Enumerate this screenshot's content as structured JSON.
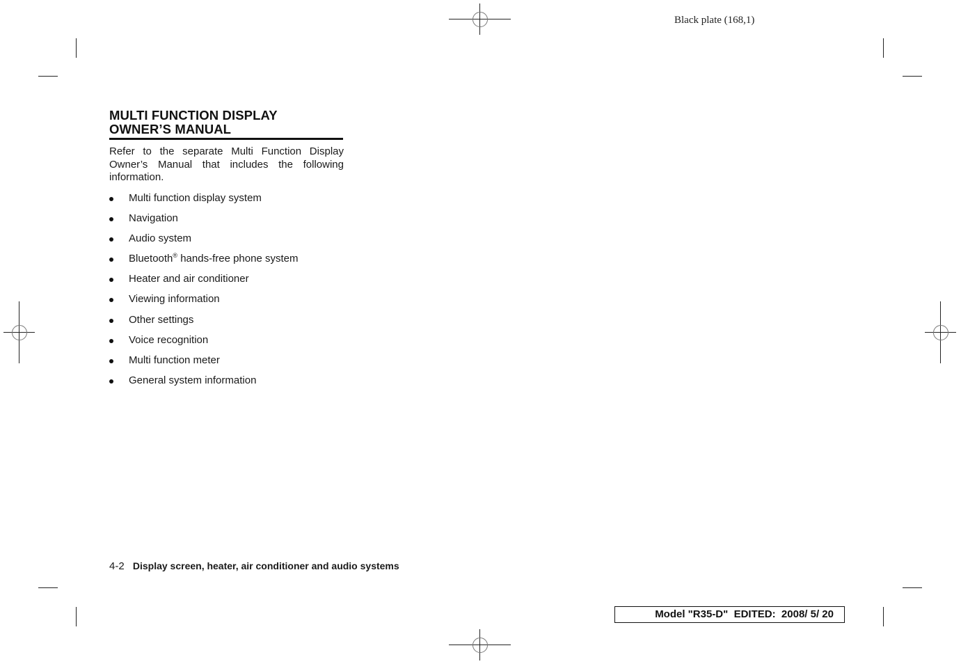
{
  "plate_label": "Black plate (168,1)",
  "section": {
    "heading_line1": "MULTI FUNCTION DISPLAY",
    "heading_line2": "OWNER’S MANUAL",
    "intro": "Refer to the separate Multi Function Display Owner’s Manual that includes the following information.",
    "items": [
      {
        "text": "Multi function display system"
      },
      {
        "text": "Navigation"
      },
      {
        "text": "Audio system"
      },
      {
        "text": "Bluetooth",
        "sup": "®",
        "rest": " hands-free phone system"
      },
      {
        "text": "Heater and air conditioner"
      },
      {
        "text": "Viewing information"
      },
      {
        "text": "Other settings"
      },
      {
        "text": "Voice recognition"
      },
      {
        "text": "Multi function meter"
      },
      {
        "text": "General system information"
      }
    ]
  },
  "footer": {
    "page_number": "4-2",
    "section_title": "Display screen, heater, air conditioner and audio systems"
  },
  "model_info": "Model \"R35-D\"  EDITED:  2008/ 5/ 20"
}
